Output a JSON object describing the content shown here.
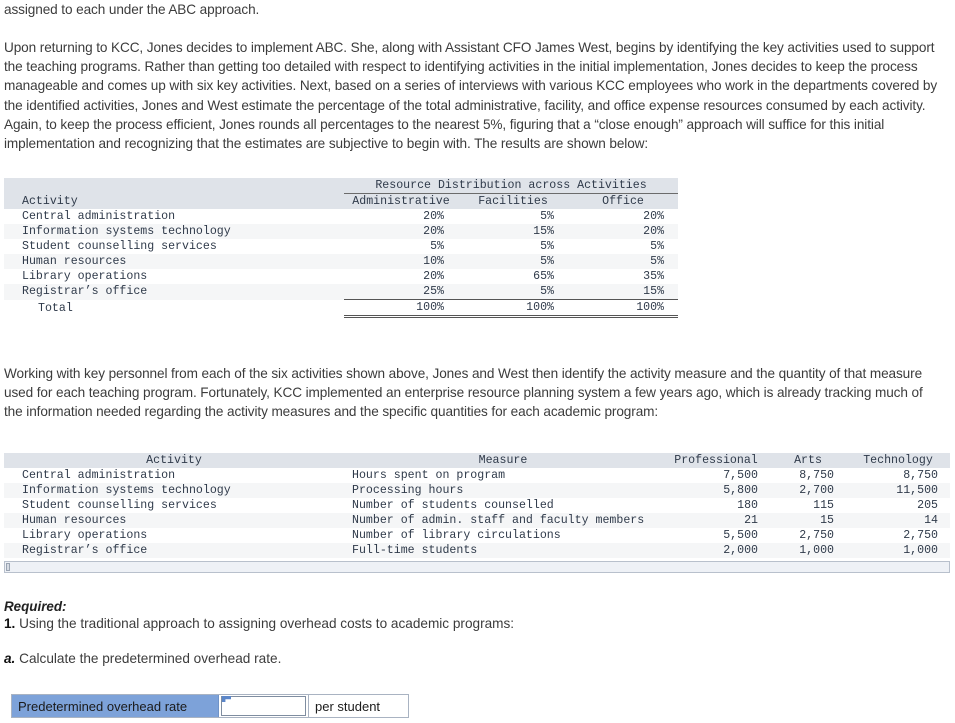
{
  "prose": {
    "intro_line": "assigned to each under the ABC approach.",
    "para_abc": "Upon returning to KCC, Jones decides to implement ABC. She, along with Assistant CFO James West, begins by identifying the key activities used to support the teaching programs. Rather than getting too detailed with respect to identifying activities in the initial implementation, Jones decides to keep the process manageable and comes up with six key activities. Next, based on a series of interviews with various KCC employees who work in the departments covered by the identified activities, Jones and West estimate the percentage of the total administrative, facility, and office expense resources consumed by each activity. Again, to keep the process efficient, Jones rounds all percentages to the nearest 5%, figuring that a “close enough” approach will suffice for this initial implementation and recognizing that the estimates are subjective to begin with. The results are shown below:",
    "para_measure": "Working with key personnel from each of the six activities shown above, Jones and West then identify the activity measure and the quantity of that measure used for each teaching program. Fortunately, KCC implemented an enterprise resource planning system a few years ago, which is already tracking much of the information needed regarding the activity measures and the specific quantities for each academic program:"
  },
  "resource_table": {
    "group_header": "Resource Distribution across Activities",
    "columns": [
      "Activity",
      "Administrative",
      "Facilities",
      "Office"
    ],
    "rows": [
      {
        "activity": "Central administration",
        "administrative": "20%",
        "facilities": "5%",
        "office": "20%"
      },
      {
        "activity": "Information systems technology",
        "administrative": "20%",
        "facilities": "15%",
        "office": "20%"
      },
      {
        "activity": "Student counselling services",
        "administrative": "5%",
        "facilities": "5%",
        "office": "5%"
      },
      {
        "activity": "Human resources",
        "administrative": "10%",
        "facilities": "5%",
        "office": "5%"
      },
      {
        "activity": "Library operations",
        "administrative": "20%",
        "facilities": "65%",
        "office": "35%"
      },
      {
        "activity": "Registrar’s office",
        "administrative": "25%",
        "facilities": "5%",
        "office": "15%"
      }
    ],
    "total": {
      "label": "Total",
      "administrative": "100%",
      "facilities": "100%",
      "office": "100%"
    }
  },
  "measure_table": {
    "columns": [
      "Activity",
      "Measure",
      "Professional",
      "Arts",
      "Technology"
    ],
    "rows": [
      {
        "activity": "Central administration",
        "measure": "Hours spent on program",
        "professional": "7,500",
        "arts": "8,750",
        "technology": "8,750"
      },
      {
        "activity": "Information systems technology",
        "measure": "Processing hours",
        "professional": "5,800",
        "arts": "2,700",
        "technology": "11,500"
      },
      {
        "activity": "Student counselling services",
        "measure": "Number of students counselled",
        "professional": "180",
        "arts": "115",
        "technology": "205"
      },
      {
        "activity": "Human resources",
        "measure": "Number of admin. staff and faculty members",
        "professional": "21",
        "arts": "15",
        "technology": "14"
      },
      {
        "activity": "Library operations",
        "measure": "Number of library circulations",
        "professional": "5,500",
        "arts": "2,750",
        "technology": "2,750"
      },
      {
        "activity": "Registrar’s office",
        "measure": "Full-time students",
        "professional": "2,000",
        "arts": "1,000",
        "technology": "1,000"
      }
    ]
  },
  "required": {
    "heading": "Required:",
    "item_1_number": "1.",
    "item_1_text": "Using the traditional approach to assigning overhead costs to academic programs:",
    "item_a_number": "a.",
    "item_a_text": "Calculate the predetermined overhead rate."
  },
  "answer": {
    "label": "Predetermined overhead rate",
    "value": "",
    "placeholder": "",
    "unit": "per student"
  },
  "colors": {
    "header_bg": "#dfe3e9",
    "row_stripe": "#f5f6f7",
    "answer_label_bg": "#7da2d9",
    "text": "#3c3c3c",
    "table_text": "#2f3a4a"
  }
}
